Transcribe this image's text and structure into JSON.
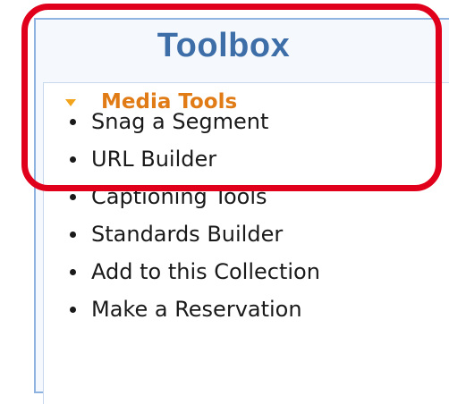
{
  "toolbox": {
    "title": "Toolbox",
    "section": {
      "label": "Media Tools",
      "icon": "triangle-down-icon",
      "expanded": true
    },
    "items": [
      {
        "label": "Snag a Segment"
      },
      {
        "label": "URL Builder"
      },
      {
        "label": "Captioning Tools"
      },
      {
        "label": "Standards Builder"
      },
      {
        "label": "Add to this Collection"
      },
      {
        "label": "Make a Reservation"
      }
    ]
  },
  "colors": {
    "title": "#3d6ea8",
    "section_label": "#e07b16",
    "triangle": "#f2a51c",
    "highlight": "#e1001c",
    "panel_border": "#8eb3e0",
    "panel_bg": "#f5f9fe"
  }
}
